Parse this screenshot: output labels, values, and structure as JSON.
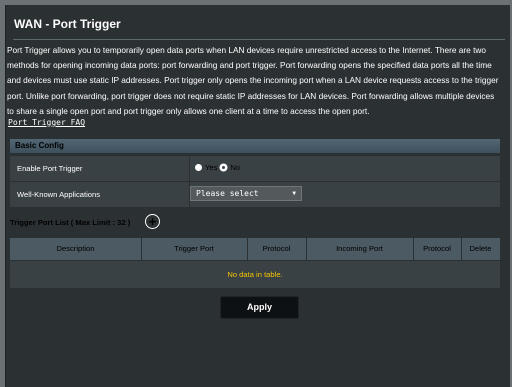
{
  "page": {
    "title": "WAN - Port Trigger",
    "description": "Port Trigger allows you to temporarily open data ports when LAN devices require unrestricted access to the Internet. There are two methods for opening incoming data ports: port forwarding and port trigger. Port forwarding opens the specified data ports all the time and devices must use static IP addresses. Port trigger only opens the incoming port when a LAN device requests access to the trigger port. Unlike port forwarding, port trigger does not require static IP addresses for LAN devices. Port forwarding allows multiple devices to share a single open port and port trigger only allows one client at a time to access the open port.",
    "faq_link": "Port Trigger FAQ"
  },
  "basic_config": {
    "header": "Basic Config",
    "enable_label": "Enable Port Trigger",
    "yes_label": "Yes",
    "no_label": "No",
    "enable_value": "No",
    "apps_label": "Well-Known Applications",
    "apps_selected": "Please select"
  },
  "trigger_list": {
    "title": "Trigger Port List ( Max Limit : 32 )",
    "add_icon": "plus-circle-icon",
    "columns": [
      "Description",
      "Trigger Port",
      "Protocol",
      "Incoming Port",
      "Protocol",
      "Delete"
    ],
    "empty_text": "No data in table."
  },
  "actions": {
    "apply_label": "Apply"
  },
  "colors": {
    "background": "#2b3033",
    "section_header": "#4b5a63",
    "empty_text": "#f5c400"
  }
}
